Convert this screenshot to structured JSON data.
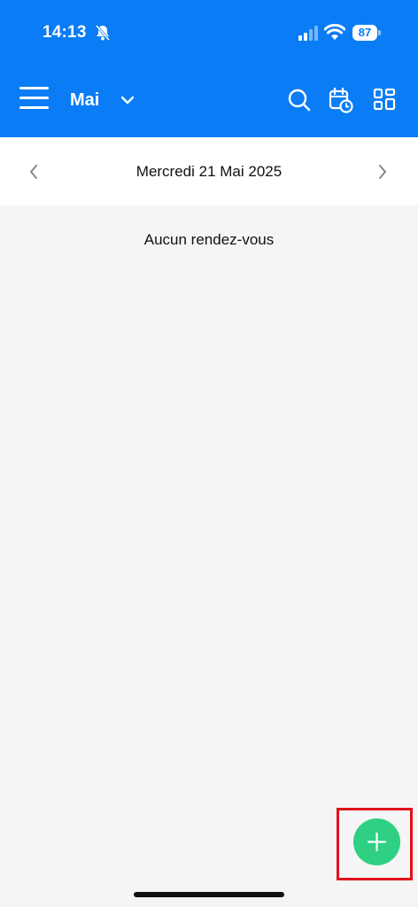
{
  "status_bar": {
    "time": "14:13",
    "battery": "87",
    "icons": [
      "bell-slash-icon",
      "signal-icon",
      "wifi-icon",
      "battery-icon"
    ]
  },
  "header": {
    "title": "Mai",
    "icons": [
      "menu-icon",
      "chevron-down-icon",
      "search-icon",
      "calendar-clock-icon",
      "grid-icon"
    ],
    "background_color": "#0a7cf5"
  },
  "date_nav": {
    "date": "Mercredi 21 Mai 2025",
    "icons": [
      "chevron-left-icon",
      "chevron-right-icon"
    ]
  },
  "content": {
    "empty_message": "Aucun rendez-vous"
  },
  "fab": {
    "icon": "plus-icon",
    "color": "#2fd083",
    "highlight_color": "#e0101a"
  }
}
